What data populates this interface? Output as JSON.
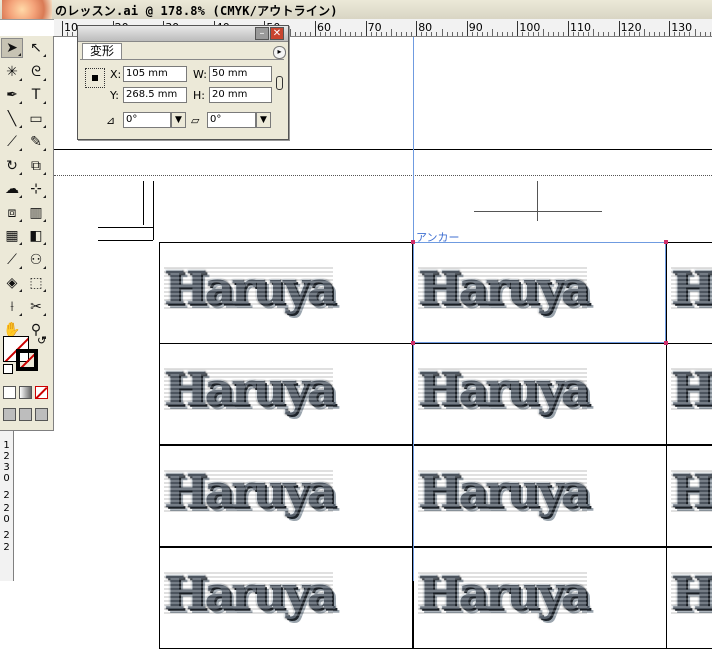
{
  "window": {
    "title": "のレッスン.ai @ 178.8% (CMYK/アウトライン)"
  },
  "ruler": {
    "labels": [
      "10",
      "20",
      "30",
      "40",
      "50",
      "60",
      "70",
      "80",
      "90",
      "100",
      "110",
      "120",
      "130"
    ],
    "vertical_labels": [
      "1",
      "2",
      "3",
      "0",
      "2",
      "2",
      "0",
      "2",
      "2"
    ]
  },
  "transform_palette": {
    "tab_label": "変形",
    "x_label": "X:",
    "x_value": "105 mm",
    "y_label": "Y:",
    "y_value": "268.5 mm",
    "w_label": "W:",
    "w_value": "50 mm",
    "h_label": "H:",
    "h_value": "20 mm",
    "rotate_value": "0°",
    "shear_value": "0°",
    "minimize_glyph": "–",
    "close_glyph": "✕",
    "menu_glyph": "▸"
  },
  "artboard": {
    "anchor_label": "アンカー",
    "repeated_word": "Haruya"
  },
  "colors": {
    "guide": "#6f9be0",
    "anchor_point": "#d0306a",
    "close_button": "#c8442e"
  }
}
